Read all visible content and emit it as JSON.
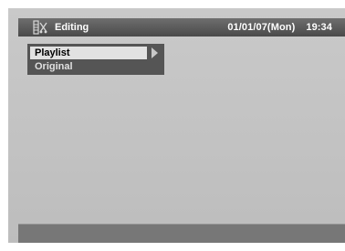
{
  "header": {
    "icon": "editing-film-icon",
    "title": "Editing",
    "date": "01/01/07(Mon)",
    "time": "19:34"
  },
  "menu": {
    "items": [
      {
        "label": "Playlist",
        "selected": true,
        "has_submenu": true
      },
      {
        "label": "Original",
        "selected": false,
        "has_submenu": false
      }
    ]
  },
  "status_bar": {
    "text": ""
  },
  "colors": {
    "background": "#c3c3c3",
    "title_bar": "#5a5a5a",
    "menu_bg": "#555555",
    "selected_item": "#e2e2e2"
  }
}
